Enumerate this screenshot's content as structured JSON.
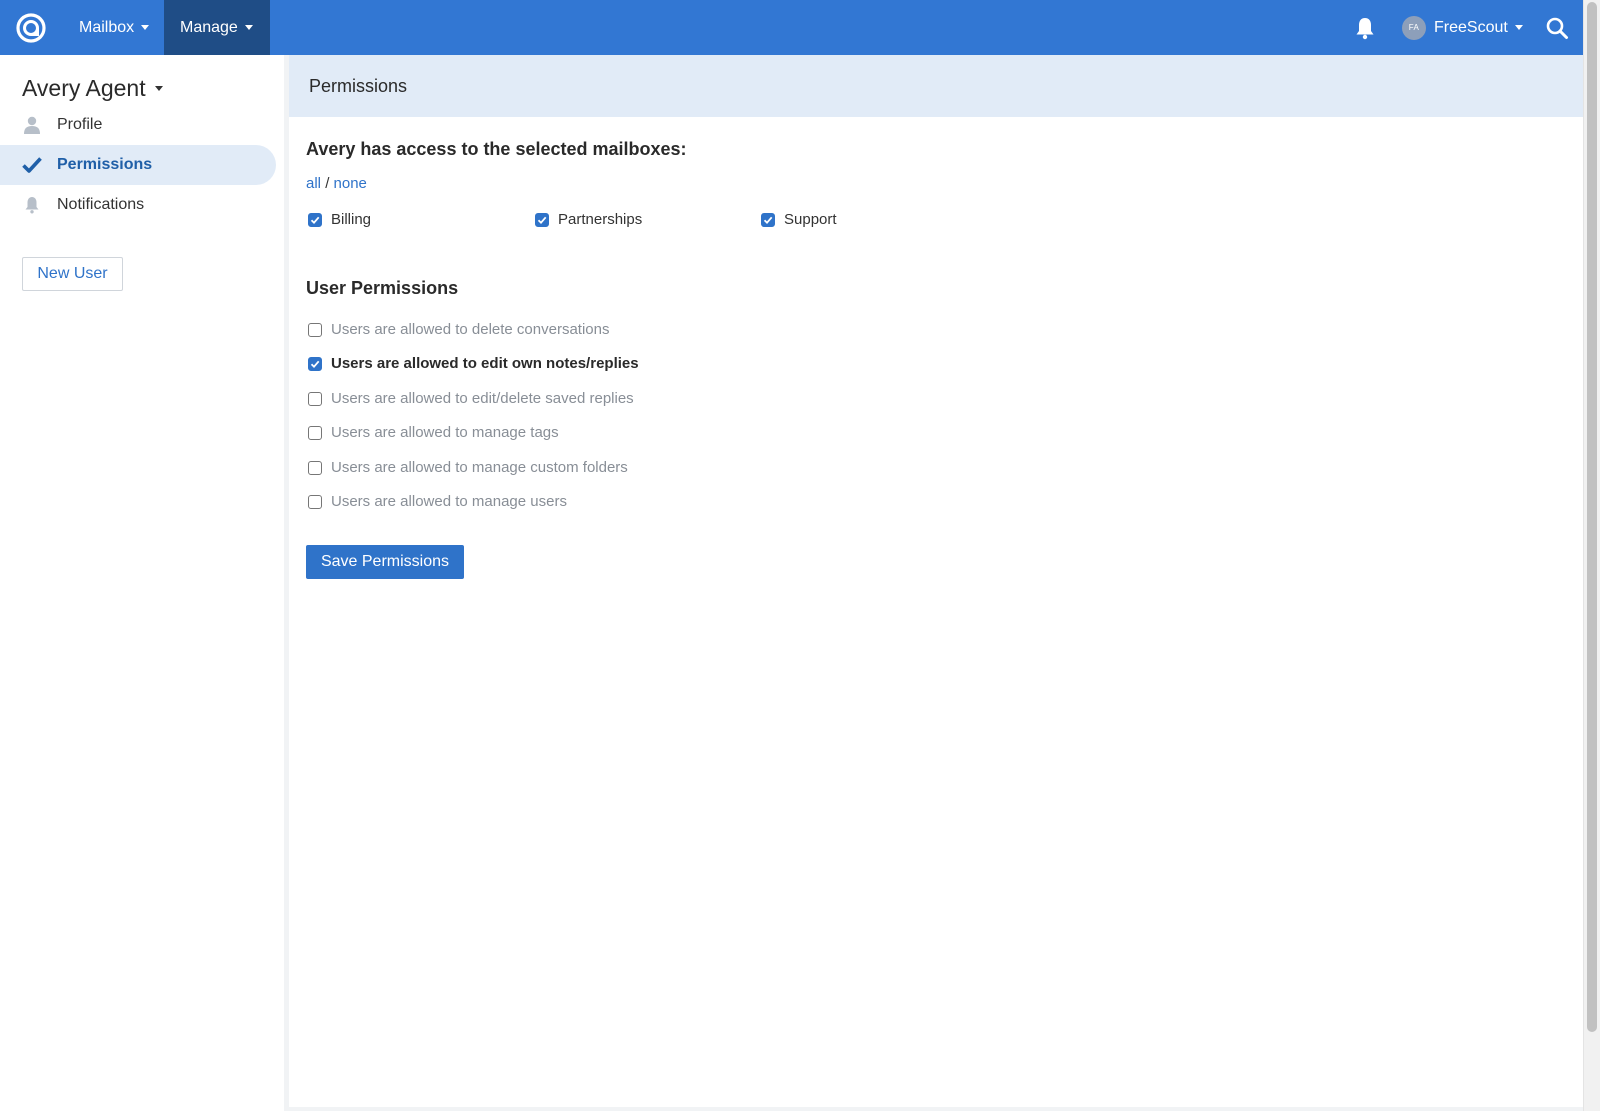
{
  "navbar": {
    "mailbox_label": "Mailbox",
    "manage_label": "Manage",
    "user_initials": "FA",
    "user_name": "FreeScout"
  },
  "sidebar": {
    "title": "Avery Agent",
    "items": [
      {
        "label": "Profile",
        "icon": "user-icon"
      },
      {
        "label": "Permissions",
        "icon": "checkmark-icon",
        "active": true
      },
      {
        "label": "Notifications",
        "icon": "bell-icon"
      }
    ],
    "new_user_label": "New User"
  },
  "page": {
    "header": "Permissions",
    "access_title": "Avery has access to the selected mailboxes:",
    "all_link": "all",
    "separator": "/",
    "none_link": "none",
    "mailboxes": [
      {
        "label": "Billing",
        "checked": true
      },
      {
        "label": "Partnerships",
        "checked": true
      },
      {
        "label": "Support",
        "checked": true
      }
    ],
    "user_permissions_title": "User Permissions",
    "permissions": [
      {
        "label": "Users are allowed to delete conversations",
        "checked": false
      },
      {
        "label": "Users are allowed to edit own notes/replies",
        "checked": true
      },
      {
        "label": "Users are allowed to edit/delete saved replies",
        "checked": false
      },
      {
        "label": "Users are allowed to manage tags",
        "checked": false
      },
      {
        "label": "Users are allowed to manage custom folders",
        "checked": false
      },
      {
        "label": "Users are allowed to manage users",
        "checked": false
      }
    ],
    "save_label": "Save Permissions"
  },
  "colors": {
    "navbar": "#3277d3",
    "navbar_active": "#1f4d86",
    "accent": "#2f73c9",
    "active_bg": "#e1ebf7"
  }
}
